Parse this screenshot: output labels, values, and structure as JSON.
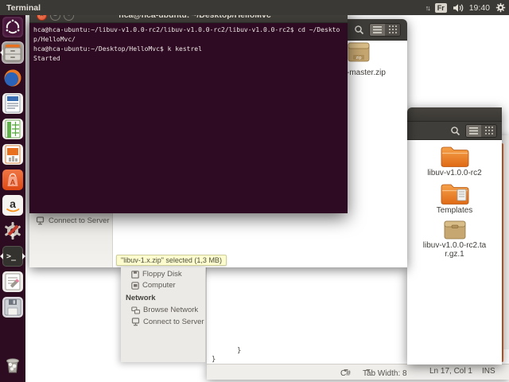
{
  "panel": {
    "app_title": "Terminal",
    "keyboard_indicator": "Fr",
    "clock": "19:40"
  },
  "launcher": {
    "items": [
      "dash",
      "files",
      "firefox",
      "libreoffice-writer",
      "libreoffice-calc",
      "libreoffice-impress",
      "software-center",
      "amazon",
      "system-settings",
      "terminal",
      "gedit",
      "floppy-disk",
      "trash"
    ]
  },
  "terminal": {
    "title": "hca@hca-ubuntu: ~/Desktop/HelloMvc",
    "lines": [
      "hca@hca-ubuntu:~/libuv-v1.0.0-rc2/libuv-v1.0.0-rc2/libuv-v1.0.0-rc2$ cd ~/Deskto",
      "p/HelloMvc/",
      "hca@hca-ubuntu:~/Desktop/HelloMvc$ k kestrel",
      "Started"
    ]
  },
  "back_window": {
    "file_label": "-master.zip",
    "zip_badge": "zip",
    "sidebar_item": "Connect to Server",
    "selection_tooltip": "\"libuv-1.x.zip\" selected  (1,3 MB)"
  },
  "places_sidebar": {
    "items": [
      "Floppy Disk",
      "Computer"
    ],
    "section_header": "Network",
    "network_items": [
      "Browse Network",
      "Connect to Server"
    ]
  },
  "right_window": {
    "files": [
      {
        "name": "libuv-v1.0.0-rc2",
        "type": "folder"
      },
      {
        "name": "Templates",
        "type": "folder"
      },
      {
        "name": "libuv-v1.0.0-rc2.tar.gz.1",
        "type": "archive"
      }
    ]
  },
  "gedit": {
    "text_fragments": [
      "}",
      "}"
    ],
    "status": {
      "language": "C#",
      "tab_width": "Tab Width: 8",
      "cursor": "Ln 17, Col 1",
      "mode": "INS"
    }
  },
  "colors": {
    "ubuntu_orange": "#dd4814",
    "terminal_bg": "#2f0a23",
    "panel_bg": "#3a3936",
    "wallpaper_purple": "#451331",
    "wallpaper_orange": "#c75f24",
    "folder_orange": "#e8701e",
    "tooltip_bg": "#fcfccf",
    "scrollbar_orange": "#e0662e"
  }
}
